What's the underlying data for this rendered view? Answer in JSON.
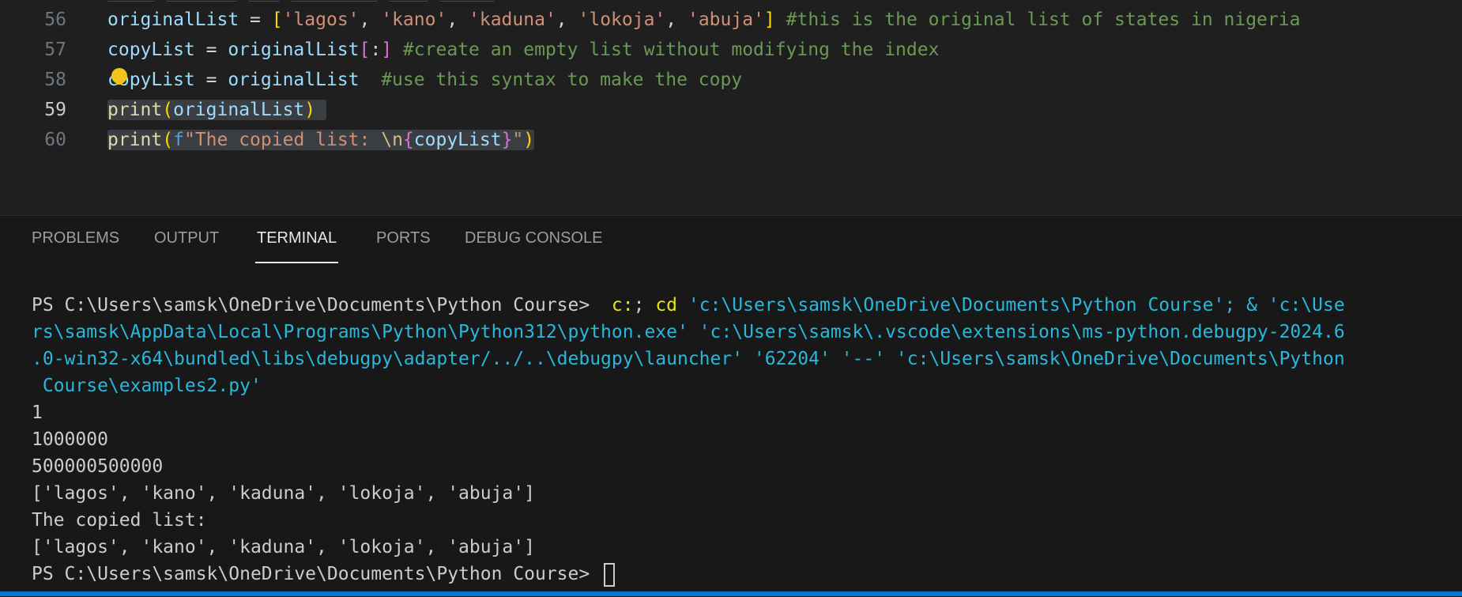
{
  "editor": {
    "lines": [
      {
        "number": "56",
        "tokens": [
          {
            "t": "originalList",
            "c": "var"
          },
          {
            "t": " = ",
            "c": "op"
          },
          {
            "t": "[",
            "c": "br1"
          },
          {
            "t": "'lagos'",
            "c": "str"
          },
          {
            "t": ", ",
            "c": "op"
          },
          {
            "t": "'kano'",
            "c": "str"
          },
          {
            "t": ", ",
            "c": "op"
          },
          {
            "t": "'kaduna'",
            "c": "str"
          },
          {
            "t": ", ",
            "c": "op"
          },
          {
            "t": "'lokoja'",
            "c": "str"
          },
          {
            "t": ", ",
            "c": "op"
          },
          {
            "t": "'abuja'",
            "c": "str"
          },
          {
            "t": "]",
            "c": "br1"
          },
          {
            "t": " #this is the original list of states in nigeria",
            "c": "cmt"
          }
        ]
      },
      {
        "number": "57",
        "tokens": [
          {
            "t": "copyList",
            "c": "var"
          },
          {
            "t": " = ",
            "c": "op"
          },
          {
            "t": "originalList",
            "c": "var"
          },
          {
            "t": "[",
            "c": "br2"
          },
          {
            "t": ":",
            "c": "op"
          },
          {
            "t": "]",
            "c": "br2"
          },
          {
            "t": " #create an empty list without modifying the index",
            "c": "cmt"
          }
        ]
      },
      {
        "number": "58",
        "tokens": [
          {
            "t": "copyList",
            "c": "var"
          },
          {
            "t": " = ",
            "c": "op"
          },
          {
            "t": "originalList",
            "c": "var"
          },
          {
            "t": "  #use this syntax to make the copy",
            "c": "cmt"
          }
        ]
      },
      {
        "number": "59",
        "active": true,
        "selected": true,
        "tokens": [
          {
            "t": "print",
            "c": "fn"
          },
          {
            "t": "(",
            "c": "br1"
          },
          {
            "t": "originalList",
            "c": "var"
          },
          {
            "t": ")",
            "c": "br1"
          },
          {
            "t": " ",
            "c": "op"
          }
        ]
      },
      {
        "number": "60",
        "selected": true,
        "tokens": [
          {
            "t": "print",
            "c": "fn"
          },
          {
            "t": "(",
            "c": "br1"
          },
          {
            "t": "f",
            "c": "fstr"
          },
          {
            "t": "\"The copied list: ",
            "c": "str"
          },
          {
            "t": "\\n",
            "c": "esc"
          },
          {
            "t": "{",
            "c": "br2"
          },
          {
            "t": "copyList",
            "c": "var"
          },
          {
            "t": "}",
            "c": "br2"
          },
          {
            "t": "\"",
            "c": "str"
          },
          {
            "t": ")",
            "c": "br1"
          }
        ]
      }
    ]
  },
  "panel": {
    "tabs": [
      "PROBLEMS",
      "OUTPUT",
      "TERMINAL",
      "PORTS",
      "DEBUG CONSOLE"
    ],
    "active_tab": "TERMINAL"
  },
  "terminal": {
    "prompt": "PS C:\\Users\\samsk\\OneDrive\\Documents\\Python Course> ",
    "cmd_part1": " c:",
    "cmd_part2": "; ",
    "cmd_part3": "cd",
    "cmd_wrapped": [
      " 'c:\\Users\\samsk\\OneDrive\\Documents\\Python Course'; & 'c:\\Use",
      "rs\\samsk\\AppData\\Local\\Programs\\Python\\Python312\\python.exe' 'c:\\Users\\samsk\\.vscode\\extensions\\ms-python.debugpy-2024.6",
      ".0-win32-x64\\bundled\\libs\\debugpy\\adapter/../..\\debugpy\\launcher' '62204' '--' 'c:\\Users\\samsk\\OneDrive\\Documents\\Python",
      " Course\\examples2.py'"
    ],
    "output": [
      "1",
      "1000000",
      "500000500000",
      "['lagos', 'kano', 'kaduna', 'lokoja', 'abuja']",
      "The copied list: ",
      "['lagos', 'kano', 'kaduna', 'lokoja', 'abuja']"
    ],
    "final_prompt": "PS C:\\Users\\samsk\\OneDrive\\Documents\\Python Course> "
  },
  "colors": {
    "editor_bg": "#1f1f1f",
    "panel_bg": "#181818",
    "status_bar": "#0078d4",
    "lightbulb": "#f3c51a"
  }
}
